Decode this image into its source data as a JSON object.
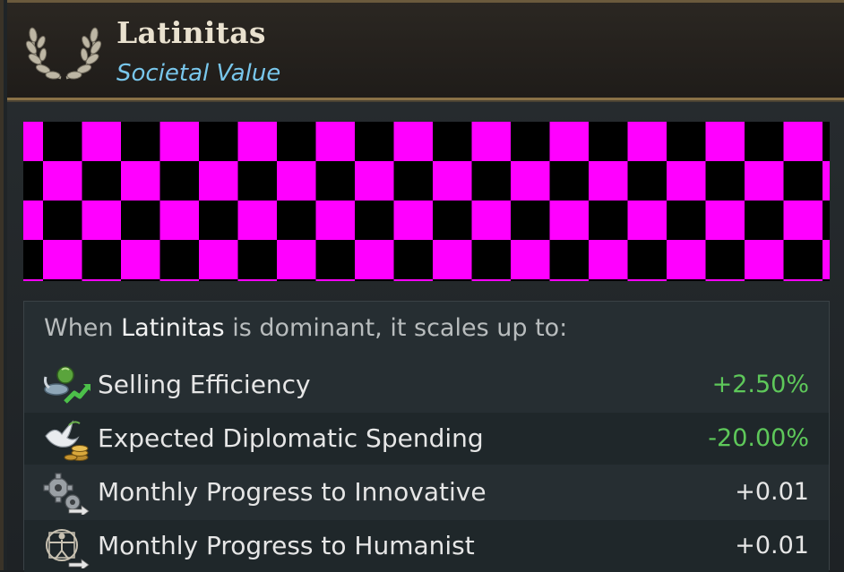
{
  "header": {
    "title": "Latinitas",
    "subtitle": "Societal Value",
    "emblem_icon": "laurel-wreath-icon"
  },
  "effects": {
    "intro_prefix": "When ",
    "intro_highlight": "Latinitas",
    "intro_suffix": " is dominant, it scales up to:",
    "rows": [
      {
        "icon": "trade-goods-icon",
        "label": "Selling Efficiency",
        "value": "+2.50%",
        "value_color": "#5ec85a"
      },
      {
        "icon": "dove-coins-icon",
        "label": "Expected Diplomatic Spending",
        "value": "-20.00%",
        "value_color": "#5ec85a"
      },
      {
        "icon": "gears-icon",
        "label": "Monthly Progress to Innovative",
        "value": "+0.01",
        "value_color": "#e6e6e6"
      },
      {
        "icon": "vitruvian-man-icon",
        "label": "Monthly Progress to Humanist",
        "value": "+0.01",
        "value_color": "#e6e6e6"
      }
    ]
  },
  "colors": {
    "title": "#e9e1cf",
    "subtitle": "#79c7ec",
    "positive": "#5ec85a",
    "missing_texture_a": "#ff00ff",
    "missing_texture_b": "#000000"
  }
}
